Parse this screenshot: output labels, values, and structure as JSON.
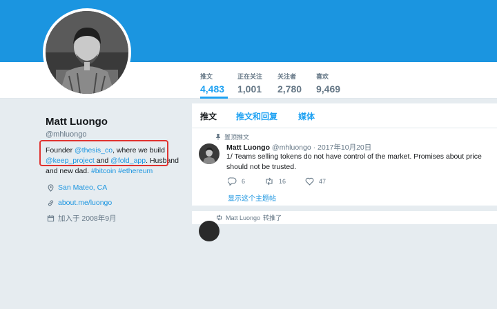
{
  "profile": {
    "name": "Matt Luongo",
    "handle": "@mhluongo",
    "bio": {
      "t1": "Founder ",
      "l1": "@thesis_co",
      "t2": ", where we build ",
      "l2": "@keep_project",
      "t3": " and ",
      "l3": "@fold_app",
      "t4": ". Husband and new dad. ",
      "l4": "#bitcoin",
      "t5": " ",
      "l5": "#ethereum"
    },
    "location": "San Mateo, CA",
    "website": "about.me/luongo",
    "joined": "加入于 2008年9月"
  },
  "stats": [
    {
      "label": "推文",
      "value": "4,483"
    },
    {
      "label": "正在关注",
      "value": "1,001"
    },
    {
      "label": "关注者",
      "value": "2,780"
    },
    {
      "label": "喜欢",
      "value": "9,469"
    }
  ],
  "tabs": [
    "推文",
    "推文和回复",
    "媒体"
  ],
  "pinned_tweet": {
    "pinned_label": "置顶推文",
    "name": "Matt Luongo",
    "handle": "@mhluongo",
    "sep": " · ",
    "date": "2017年10月20日",
    "text": "1/ Teams selling tokens do not have control of the market. Promises about price should not be trusted.",
    "replies": "6",
    "retweets": "16",
    "likes": "47",
    "thread_link": "显示这个主题帖"
  },
  "retweet_row": {
    "name": "Matt Luongo",
    "action": "转推了"
  },
  "colors": {
    "accent": "#1da1f2",
    "banner": "#1b95e0",
    "highlight": "#e0322f"
  }
}
